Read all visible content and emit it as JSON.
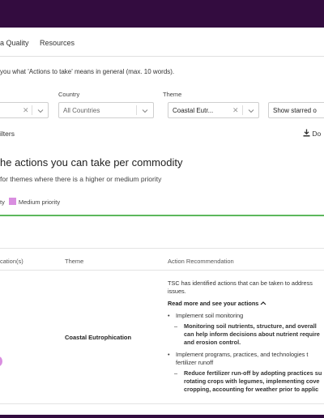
{
  "nav": {
    "items": [
      "a Quality",
      "Resources"
    ]
  },
  "question": "you what 'Actions to take' means in general (max. 10 words).",
  "filters": {
    "country_label": "Country",
    "country_value": "All Countries",
    "theme_label": "Theme",
    "theme_value": "Coastal Eutr...",
    "starred_value": "Show starred o",
    "filters_link": "ilters",
    "download": "Do"
  },
  "heading": "he actions you can take per commodity",
  "subheading": "for themes where there is a higher or medium priority",
  "legend": {
    "prefix": "ty",
    "medium": "Medium priority"
  },
  "table": {
    "headers": {
      "col1": "cation(s)",
      "col2": "Theme",
      "col3": "Action Recommendation"
    },
    "row": {
      "theme": "Coastal Eutrophication",
      "intro_1": "TSC has identified actions that can be taken to address",
      "intro_2": "issues.",
      "read_more": "Read more and see your actions",
      "b1": "Implement soil monitoring",
      "b1_sub_1": "Monitoring soil nutrients, structure, and overall",
      "b1_sub_2": "can help inform decisions about nutrient require",
      "b1_sub_3": "and erosion control.",
      "b2_1": "Implement programs, practices, and technologies t",
      "b2_2": "fertilizer runoff",
      "b2_sub_1": "Reduce fertilizer run-off by adopting practices su",
      "b2_sub_2": "rotating crops with legumes, implementing cove",
      "b2_sub_3": "cropping, accounting for weather prior to applic"
    }
  },
  "colors": {
    "header": "#330c3f",
    "accent_green": "#5cb85c",
    "medium_priority": "#d98ee0"
  }
}
